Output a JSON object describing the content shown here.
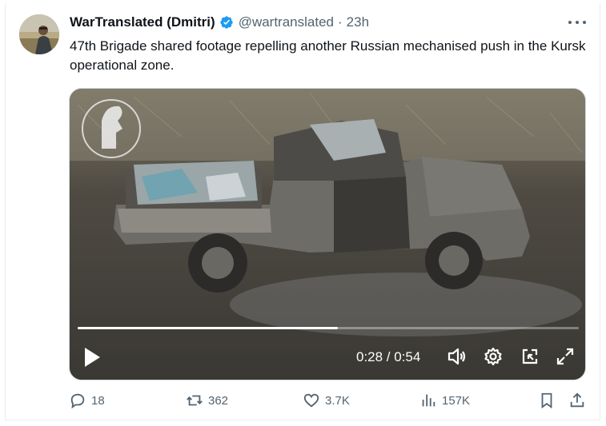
{
  "tweet": {
    "display_name": "WarTranslated (Dmitri)",
    "handle": "@wartranslated",
    "separator": "·",
    "time_ago": "23h",
    "text": "47th Brigade shared footage repelling another Russian mechanised push in the Kursk operational zone.",
    "verified_color": "#1d9bf0"
  },
  "video": {
    "current_time": "0:28",
    "duration": "0:54",
    "time_display": "0:28 / 0:54",
    "progress_fraction": 0.519
  },
  "actions": {
    "replies": "18",
    "reposts": "362",
    "likes": "3.7K",
    "views": "157K"
  },
  "colors": {
    "text_primary": "#0f1419",
    "text_secondary": "#536471",
    "accent": "#1d9bf0"
  },
  "icons": [
    "more-icon",
    "verified-icon",
    "play-icon",
    "volume-icon",
    "settings-icon",
    "pip-icon",
    "fullscreen-icon",
    "reply-icon",
    "repost-icon",
    "like-icon",
    "views-icon",
    "bookmark-icon",
    "share-icon"
  ]
}
